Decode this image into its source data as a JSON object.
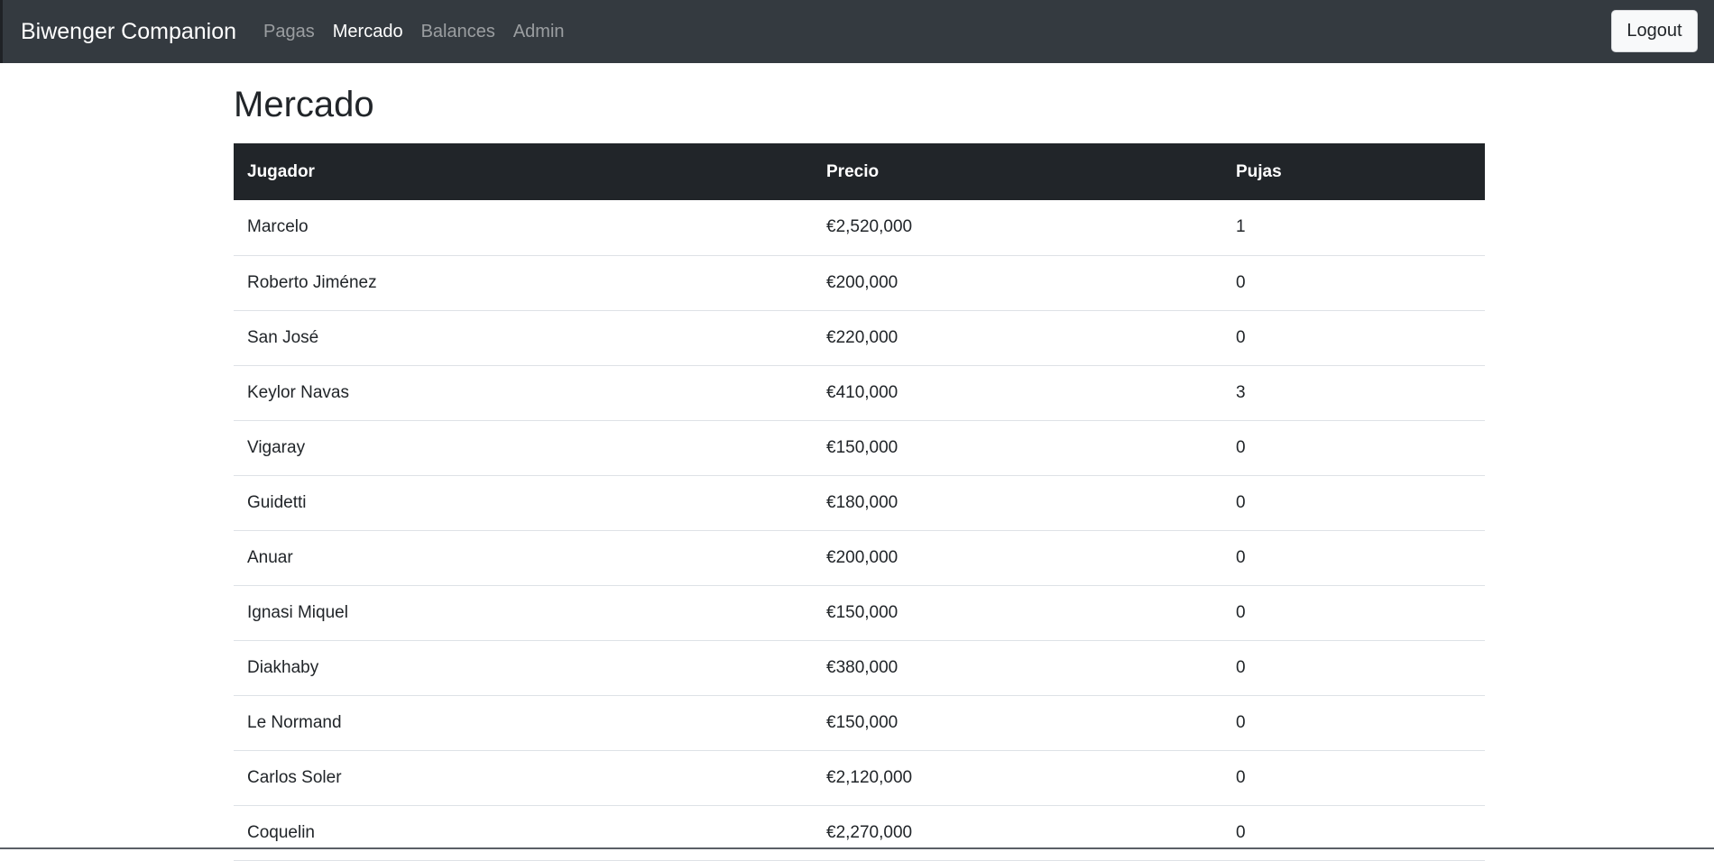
{
  "navbar": {
    "brand": "Biwenger Companion",
    "links": [
      {
        "label": "Pagas"
      },
      {
        "label": "Mercado"
      },
      {
        "label": "Balances"
      },
      {
        "label": "Admin"
      }
    ],
    "active": "Mercado",
    "logout_label": "Logout"
  },
  "page": {
    "title": "Mercado"
  },
  "table": {
    "headers": [
      "Jugador",
      "Precio",
      "Pujas"
    ],
    "rows": [
      [
        "Marcelo",
        "€2,520,000",
        "1"
      ],
      [
        "Roberto Jiménez",
        "€200,000",
        "0"
      ],
      [
        "San José",
        "€220,000",
        "0"
      ],
      [
        "Keylor Navas",
        "€410,000",
        "3"
      ],
      [
        "Vigaray",
        "€150,000",
        "0"
      ],
      [
        "Guidetti",
        "€180,000",
        "0"
      ],
      [
        "Anuar",
        "€200,000",
        "0"
      ],
      [
        "Ignasi Miquel",
        "€150,000",
        "0"
      ],
      [
        "Diakhaby",
        "€380,000",
        "0"
      ],
      [
        "Le Normand",
        "€150,000",
        "0"
      ],
      [
        "Carlos Soler",
        "€2,120,000",
        "0"
      ],
      [
        "Coquelin",
        "€2,270,000",
        "0"
      ]
    ]
  },
  "colors": {
    "navbar_bg": "#343a40",
    "table_header_bg": "#212529",
    "row_border": "#dee2e6"
  }
}
